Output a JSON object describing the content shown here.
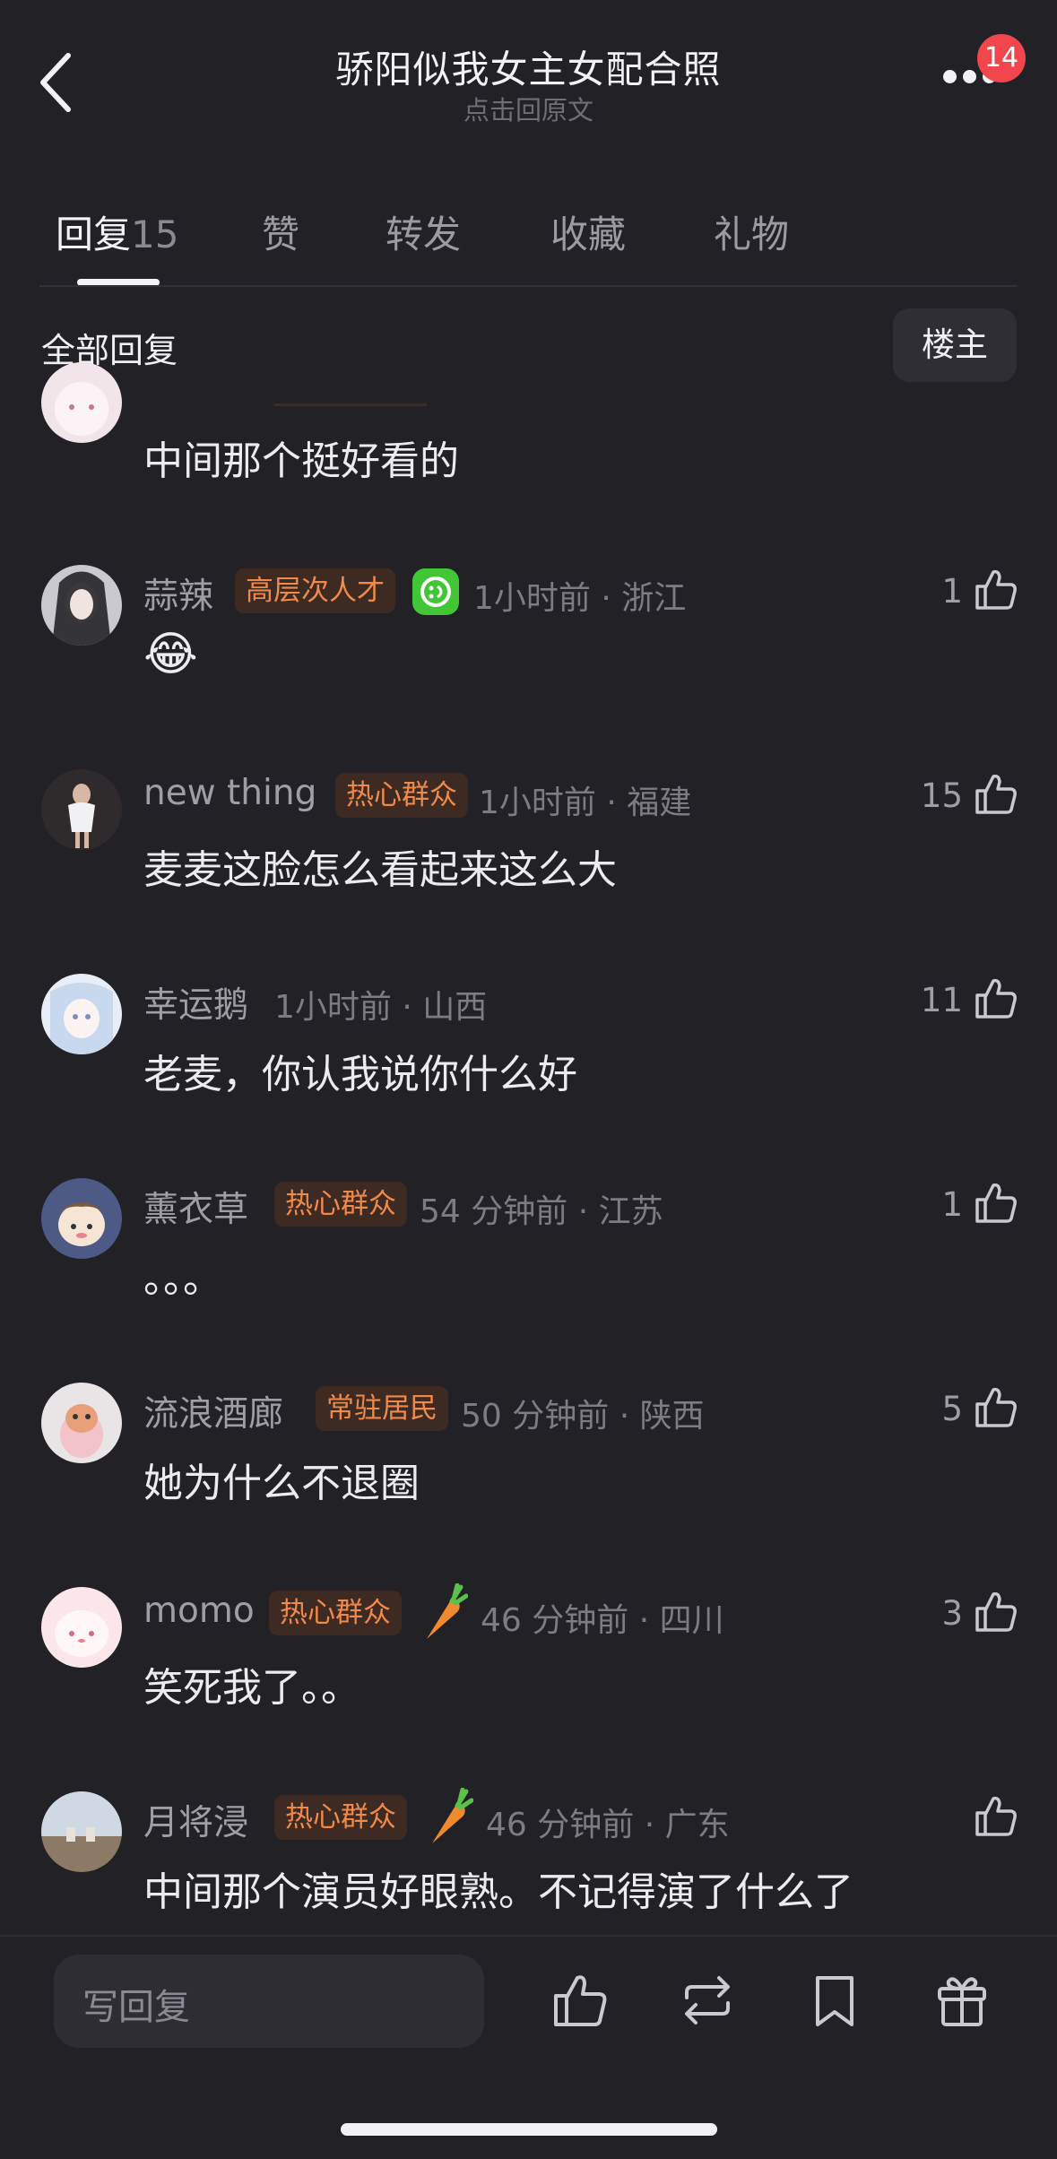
{
  "header": {
    "title": "骄阳似我女主女配合照",
    "subtitle": "点击回原文",
    "notification_count": "14"
  },
  "tabs": [
    {
      "label": "回复",
      "count": "15"
    },
    {
      "label": "赞"
    },
    {
      "label": "转发"
    },
    {
      "label": "收藏"
    },
    {
      "label": "礼物"
    }
  ],
  "section": {
    "title": "全部回复",
    "op_filter_label": "楼主"
  },
  "comments": [
    {
      "content": "中间那个挺好看的"
    },
    {
      "author": "蒜辣",
      "tag": "高层次人才",
      "meta": "1小时前 · 浙江",
      "content": "😂",
      "likes": "1",
      "icons": [
        "green-smile-badge-icon"
      ]
    },
    {
      "author": "new thing",
      "tag": "热心群众",
      "meta": "1小时前 · 福建",
      "content": "麦麦这脸怎么看起来这么大",
      "likes": "15"
    },
    {
      "author": "幸运鹅",
      "meta": "1小时前 · 山西",
      "content": "老麦，你认我说你什么好",
      "likes": "11"
    },
    {
      "author": "薰衣草",
      "tag": "热心群众",
      "meta": "54 分钟前 · 江苏",
      "content": "。。。",
      "likes": "1"
    },
    {
      "author": "流浪酒廊",
      "tag": "常驻居民",
      "meta": "50 分钟前 · 陕西",
      "content": "她为什么不退圈",
      "likes": "5"
    },
    {
      "author": "momo",
      "tag": "热心群众",
      "meta": "46 分钟前 · 四川",
      "content": "笑死我了。。",
      "likes": "3",
      "icons": [
        "carrot-icon"
      ]
    },
    {
      "author": "月将浸",
      "tag": "热心群众",
      "meta": "46 分钟前 · 广东",
      "content": "中间那个演员好眼熟。不记得演了什么了",
      "likes": "",
      "icons": [
        "carrot-icon"
      ]
    }
  ],
  "bottom_bar": {
    "reply_placeholder": "写回复",
    "icons": [
      "like-icon",
      "repost-icon",
      "bookmark-icon",
      "gift-icon"
    ]
  },
  "colors": {
    "background": "#222126",
    "tag_background": "#3d2a22",
    "tag_text": "#f08a4b",
    "badge_red": "#f2464d"
  }
}
